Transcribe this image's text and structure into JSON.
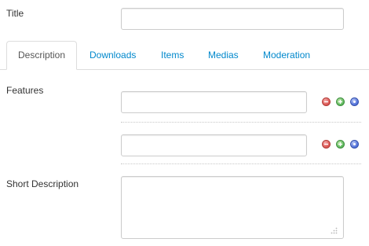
{
  "form": {
    "title_label": "Title",
    "title_value": "",
    "features_label": "Features",
    "features": [
      {
        "value": ""
      },
      {
        "value": ""
      }
    ],
    "short_description_label": "Short Description",
    "short_description_value": ""
  },
  "tabs": [
    {
      "label": "Description",
      "active": true
    },
    {
      "label": "Downloads",
      "active": false
    },
    {
      "label": "Items",
      "active": false
    },
    {
      "label": "Medias",
      "active": false
    },
    {
      "label": "Moderation",
      "active": false
    }
  ],
  "icons": {
    "remove": "minus-circle-icon",
    "add": "plus-circle-icon",
    "move": "dot-circle-icon"
  },
  "colors": {
    "link": "#0088cc",
    "remove": "#d9534f",
    "add": "#5cb85c",
    "move": "#4e6fd8"
  }
}
